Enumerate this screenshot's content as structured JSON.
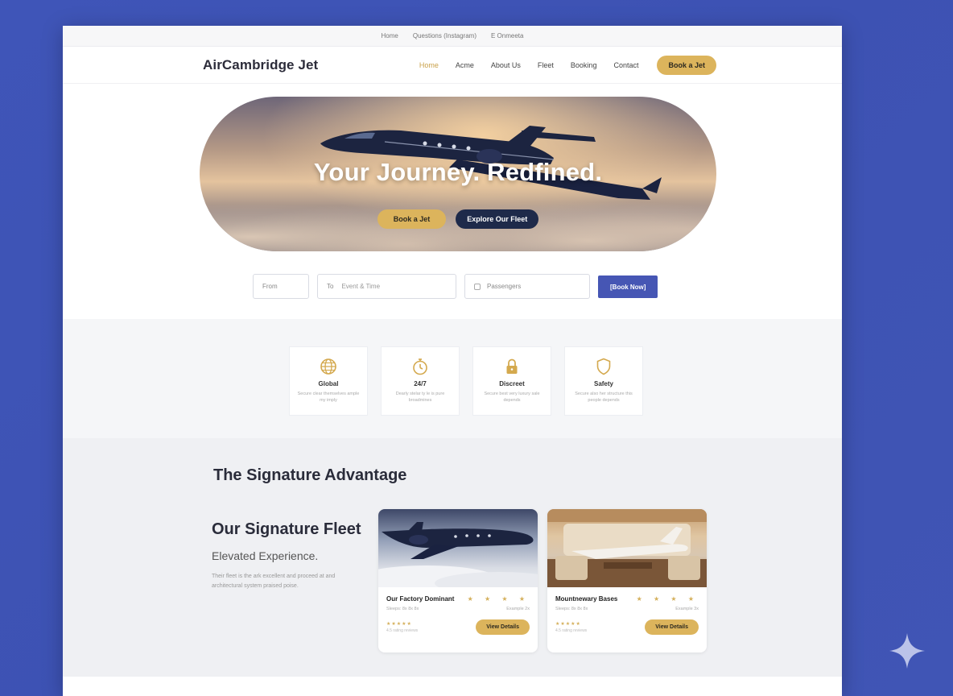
{
  "topbar": {
    "links": [
      "Home",
      "Questions (Instagram)",
      "E Onmeeta"
    ]
  },
  "header": {
    "logo": "AirCambridge Jet",
    "nav": [
      "Home",
      "Acme",
      "About Us",
      "Fleet",
      "Booking",
      "Contact"
    ],
    "active_nav": "Home",
    "cta": "Book a Jet"
  },
  "hero": {
    "title": "Your Journey. Redfined.",
    "primary_button": "Book a Jet",
    "secondary_button": "Explore Our Fleet"
  },
  "search": {
    "from_label": "From",
    "to_label": "To",
    "date_placeholder": "Event & Time",
    "passengers_placeholder": "Passengers",
    "submit": "[Book Now]"
  },
  "features": [
    {
      "icon": "globe-icon",
      "title": "Global",
      "desc": "Secure clear themselves ample my imply"
    },
    {
      "icon": "stopwatch-icon",
      "title": "24/7",
      "desc": "Dearly stelar ty le is pure broadmines"
    },
    {
      "icon": "lock-icon",
      "title": "Discreet",
      "desc": "Secure best very luxury sale depends"
    },
    {
      "icon": "shield-icon",
      "title": "Safety",
      "desc": "Secure also her structure this people depends"
    }
  ],
  "advantage": {
    "section_title": "The Signature Advantage",
    "fleet_title": "Our Signature Fleet",
    "fleet_subtitle": "Elevated Experience.",
    "fleet_body": "Their fleet is the ark excellent and proceed at and architectural system praised poise."
  },
  "cards": [
    {
      "name": "Our Factory Dominant",
      "stars": "★ ★ ★ ★",
      "meta_left": "Sleeps: 8x 8x 8x",
      "meta_right": "Example 2x",
      "small_stars": "★★★★★",
      "small_note": "4.5 rating reviews",
      "button": "View Details"
    },
    {
      "name": "Mountnewary Bases",
      "stars": "★ ★ ★ ★",
      "meta_left": "Sleeps: 8x 8x 8x",
      "meta_right": "Example 3x",
      "small_stars": "★★★★★",
      "small_note": "4.5 rating reviews",
      "button": "View Details"
    }
  ],
  "colors": {
    "accent_gold": "#dcb45c",
    "navy": "#1e2a4a",
    "primary_blue": "#4656b4",
    "background": "#3f55b8"
  }
}
